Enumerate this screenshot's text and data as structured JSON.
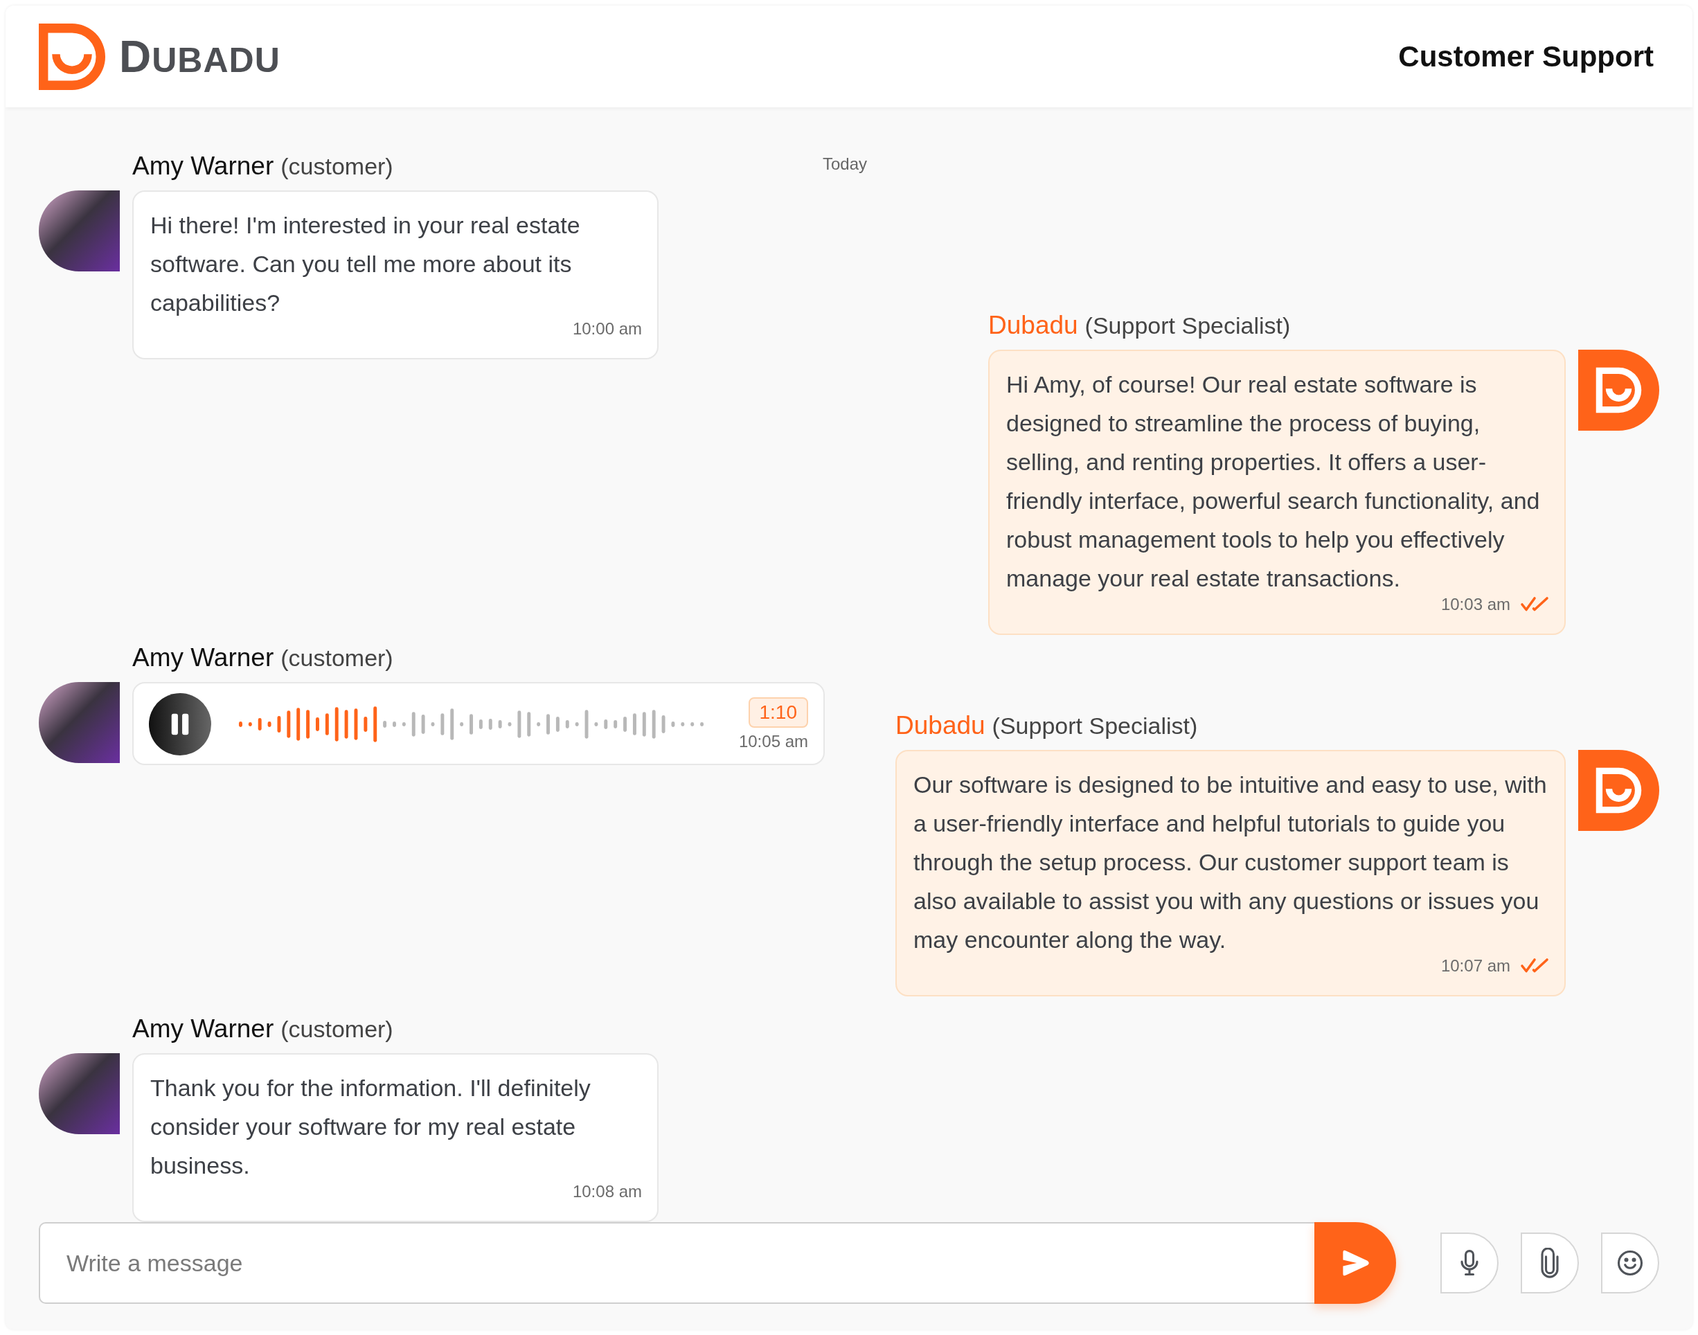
{
  "header": {
    "brand": "DUBADU",
    "title": "Customer Support"
  },
  "day_label": "Today",
  "messages": [
    {
      "outgoing": false,
      "kind": "text",
      "sender": "Amy Warner",
      "role": "(customer)",
      "text": "Hi there! I'm interested in your real estate software. Can you tell me more about its capabilities?",
      "time": "10:00 am"
    },
    {
      "outgoing": true,
      "kind": "text",
      "sender": "Dubadu",
      "role": "(Support Specialist)",
      "text": "Hi Amy, of course! Our real estate software is designed to streamline the process of buying, selling, and renting properties. It offers a user-friendly interface, powerful search functionality, and robust management tools to help you effectively manage your real estate transactions.",
      "time": "10:03 am",
      "read": true
    },
    {
      "outgoing": false,
      "kind": "voice",
      "sender": "Amy Warner",
      "role": "(customer)",
      "playing": true,
      "level": 0.3,
      "duration": "1:10",
      "time": "10:05 am"
    },
    {
      "outgoing": true,
      "kind": "text",
      "sender": "Dubadu",
      "role": "(Support Specialist)",
      "text": "Our software is designed to be intuitive and easy to use, with a user-friendly interface and helpful tutorials to guide you through the setup process. Our customer support team is also available to assist you with any questions or issues you may encounter along the way.",
      "time": "10:07 am",
      "read": true
    },
    {
      "outgoing": false,
      "kind": "text",
      "sender": "Amy Warner",
      "role": "(customer)",
      "text": "Thank you for the information. I'll definitely consider your software for my real estate business.",
      "time": "10:08 am"
    }
  ],
  "composer": {
    "placeholder": "Write a message"
  }
}
